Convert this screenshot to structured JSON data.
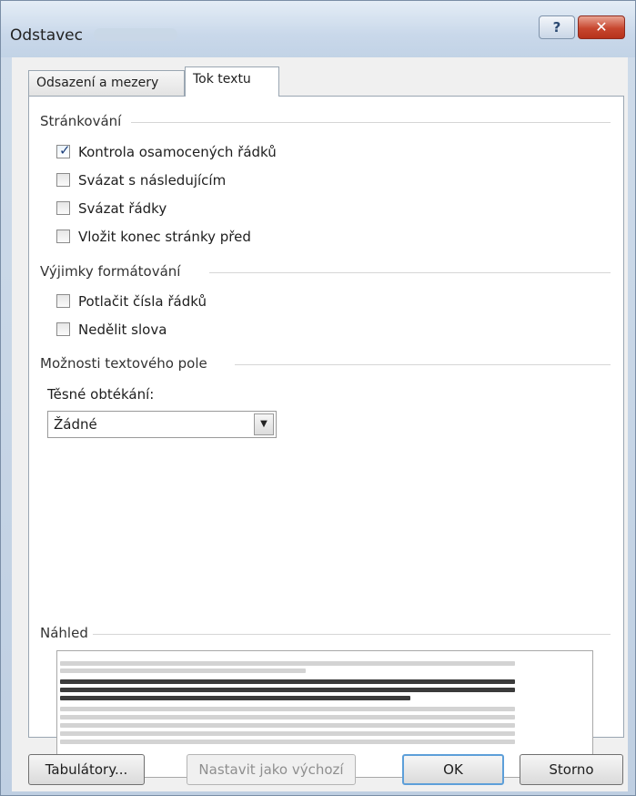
{
  "window": {
    "title": "Odstavec",
    "help_label": "?",
    "close_label": "✕"
  },
  "tabs": [
    {
      "label": "Odsazení a mezery",
      "active": false
    },
    {
      "label": "Tok textu",
      "active": true
    }
  ],
  "sections": {
    "pagination": {
      "title": "Stránkování",
      "items": [
        {
          "label": "Kontrola osamocených řádků",
          "checked": true
        },
        {
          "label": "Svázat s následujícím",
          "checked": false
        },
        {
          "label": "Svázat řádky",
          "checked": false
        },
        {
          "label": "Vložit konec stránky před",
          "checked": false
        }
      ]
    },
    "formatting_exceptions": {
      "title": "Výjimky formátování",
      "items": [
        {
          "label": "Potlačit čísla řádků",
          "checked": false
        },
        {
          "label": "Nedělit slova",
          "checked": false
        }
      ]
    },
    "textbox_options": {
      "title": "Možnosti textového pole",
      "tight_wrap_label": "Těsné obtékání:",
      "tight_wrap_value": "Žádné"
    },
    "preview": {
      "title": "Náhled"
    }
  },
  "buttons": {
    "tabs": "Tabulátory...",
    "set_default": "Nastavit jako výchozí",
    "ok": "OK",
    "cancel": "Storno"
  },
  "icons": {
    "checkmark": "✓",
    "dropdown_arrow": "▼"
  }
}
